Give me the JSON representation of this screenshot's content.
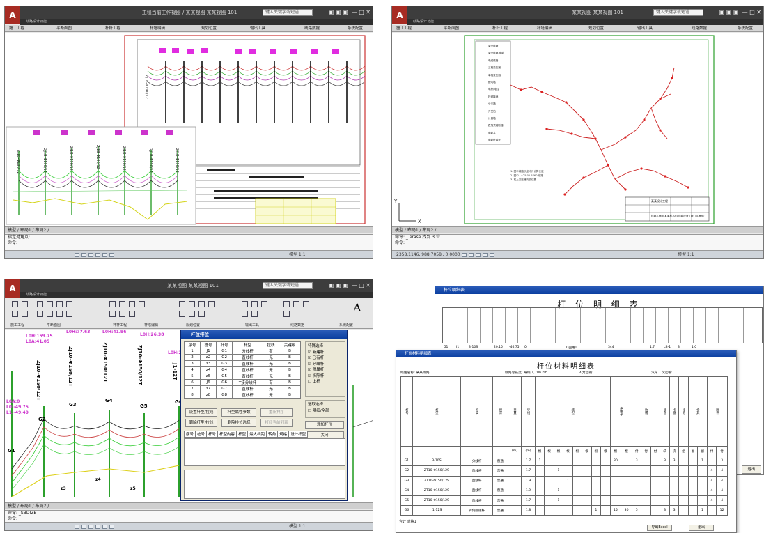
{
  "q1": {
    "title": "工程当前工作视图 / 某某视图 某某视图 101",
    "search_placeholder": "键入关键字或短语",
    "qat": "线路设计功能",
    "menus": [
      "施工工程",
      "平断面图",
      "杆杆工程",
      "杆塔编辑",
      "规划位置",
      "输出工具",
      "线路数据",
      "系统配置"
    ],
    "tabs": "模型 / 布局1 / 布局2 /",
    "cmd_lines": [
      "指定对角点:",
      "命令:"
    ],
    "plan_labels": [
      "ZJ1B-Φ190/12",
      "ZJ1B-Φ190/12",
      "ZJ1B-Φ190/12",
      "ZJ1B-Φ190/12",
      "ZJ1B-Φ190/12",
      "ZJ1B-Φ190/12",
      "ZJ1B-Φ190/12",
      "ZJ1B-Φ190/12"
    ],
    "status_left": "模型",
    "status_right": "模型 1:1"
  },
  "q2": {
    "title": "某某视图 某某视图 101",
    "search_placeholder": "键入关键字或短语",
    "qat": "线路设计功能",
    "menus": [
      "施工工程",
      "平断面图",
      "杆杆工程",
      "杆塔编辑",
      "规划位置",
      "输出工具",
      "线路数据",
      "系统配置"
    ],
    "legend": [
      "架空线路",
      "架空线路-电缆",
      "电缆线路",
      "三相变压器",
      "单相变压器",
      "配电箱",
      "电杆/电柱",
      "杆塔接地",
      "分支箱",
      "开关站",
      "计量箱",
      "跌落式熔断器",
      "电缆井",
      "电缆终端头"
    ],
    "notes": [
      "1. 图中线路长度均为计算长度",
      "2. 图中 L=25.05 5760 线路...",
      "3. 柱上变压器安装位置..."
    ],
    "title_block": {
      "company": "某某设计工程",
      "drawing": "线路平面图/某某村10kV线路改造工程（平面图）"
    },
    "tabs": "模型 / 布局1 / 布局2 /",
    "cmd_lines": [
      "命令: _.erase 找到 3 个",
      "命令:"
    ],
    "coords": "2358.1146, 988.7058 , 0.0000",
    "status_right": "模型 1:1"
  },
  "q3": {
    "title": "某某视图 某某视图 101",
    "search_placeholder": "键入关键字或短语",
    "qat": "线路设计功能",
    "ribbon_groups": [
      "施工工程",
      "平断面图",
      "杆杆工程",
      "杆塔编辑",
      "规划位置",
      "输出工具",
      "线路数据",
      "系统配置"
    ],
    "profile_labels": [
      {
        "name": "ZJ10-Φ150/12T",
        "g": "G1"
      },
      {
        "name": "ZJ10-Φ150/12T",
        "g": "G2"
      },
      {
        "name": "ZJ10-Φ150/12T",
        "g": "G3"
      },
      {
        "name": "ZJ10-Φ150/12T",
        "g": "G4"
      },
      {
        "name": "ZJ10-Φ150/12T",
        "g": "G5"
      },
      {
        "name": "J1-12T",
        "g": "G6"
      }
    ],
    "top_labels": [
      "L0H:159.75",
      "L0A:41.05",
      "L0H:77.63",
      "L0H:41.96",
      "L0H:26.38",
      "L0H:20."
    ],
    "left_labels": [
      "L0A:0",
      "L0:-49.75",
      "L1:-49.49"
    ],
    "spans": [
      "z3",
      "z4",
      "z5"
    ],
    "tabs": "模型 / 布局1 / 布局2 /",
    "cmd_lines": [
      "命令: _SBDIZB",
      "命令:"
    ],
    "status_right": "模型 1:1",
    "dialog": {
      "title": "杆位排位",
      "columns": [
        "序号",
        "桩号",
        "杆号",
        "杆型",
        "拉线",
        "关键级"
      ],
      "rows": [
        [
          "1",
          "J1",
          "G1",
          "分线杆",
          "有",
          "B"
        ],
        [
          "2",
          "z2",
          "G2",
          "直线杆",
          "无",
          "B"
        ],
        [
          "3",
          "z3",
          "G3",
          "直线杆",
          "无",
          "B"
        ],
        [
          "4",
          "z4",
          "G4",
          "直线杆",
          "无",
          "B"
        ],
        [
          "5",
          "z5",
          "G5",
          "直线杆",
          "无",
          "B"
        ],
        [
          "6",
          "J6",
          "G6",
          "T接分歧杆",
          "有",
          "B"
        ],
        [
          "7",
          "z7",
          "G7",
          "直线杆",
          "无",
          "B"
        ],
        [
          "8",
          "z8",
          "G8",
          "直线杆",
          "无",
          "B"
        ]
      ],
      "options_title": "特殊选择",
      "options": [
        "新建杆",
        "已有杆",
        "分歧杆",
        "附属杆",
        "拆除杆",
        "上杆"
      ],
      "checked": [
        true,
        true,
        true,
        true,
        true,
        false
      ],
      "range_title": "选取选择",
      "range_option": "明细/全部",
      "buttons": [
        "设置杆型/拉线",
        "杆型属性参数",
        "重新排序",
        "添加杆位",
        "删除杆型/拉线",
        "删除排位选择",
        "打印当前列表",
        "关闭"
      ],
      "columns2": [
        "序号",
        "桩号",
        "杆号",
        "杆型内容",
        "杆型",
        "最大档距",
        "转角",
        "规格",
        "设计杆型"
      ]
    }
  },
  "q4": {
    "back_window_title": "杆位明细表",
    "back_title": "杆 位 明 细 表",
    "back_first_row": [
      "G1",
      "J1",
      "3-10S",
      "",
      "20.15",
      "-46.75",
      "",
      "",
      "0",
      "",
      "",
      "G回路1",
      "344",
      "",
      "",
      "1.7",
      "LB-1",
      "3",
      "",
      "1.0"
    ],
    "front_window_title": "杆位材料明细表",
    "front_title": "杆位材料明细表",
    "info": {
      "line_name": "线路名称: 某某线路",
      "total": "线路总长度: 导线 1,708 km",
      "labor": "人力运输:",
      "vehicle": "汽车二次运输:"
    },
    "headers": [
      "杆号",
      "杆型",
      "杆高",
      "埋深",
      "重量",
      "导线",
      "横担",
      "绝缘子",
      "拉线",
      "底盘",
      "卡盘",
      "接地",
      "金具",
      "附件"
    ],
    "units": [
      "(m)",
      "(m)",
      "(t)",
      "根",
      "根",
      "付",
      "块",
      "块",
      "组",
      "副",
      "付"
    ],
    "rows": [
      [
        "G1",
        "3-10S",
        "分线杆",
        "普通",
        "",
        "1.7",
        "1",
        "",
        "",
        "",
        "",
        "",
        "",
        "",
        "30",
        "",
        "3",
        "",
        "",
        "3",
        "3",
        "",
        "",
        "1",
        "",
        "3"
      ],
      [
        "G2",
        "ZT10-Φ150/12S",
        "直线杆",
        "普通",
        "",
        "1.7",
        "",
        "",
        "1",
        "",
        "",
        "",
        "",
        "",
        "",
        "",
        "",
        "",
        "",
        "",
        "",
        "",
        "",
        "",
        "4",
        "4"
      ],
      [
        "G3",
        "ZT10-Φ150/12S",
        "直线杆",
        "普通",
        "",
        "1.9",
        "",
        "",
        "",
        "1",
        "",
        "",
        "",
        "",
        "",
        "",
        "",
        "",
        "",
        "",
        "",
        "",
        "",
        "",
        "4",
        "4"
      ],
      [
        "G4",
        "ZT10-Φ150/12S",
        "直线杆",
        "普通",
        "",
        "1.9",
        "",
        "",
        "1",
        "",
        "",
        "",
        "",
        "",
        "",
        "",
        "",
        "",
        "",
        "",
        "",
        "",
        "",
        "",
        "4",
        "4"
      ],
      [
        "G5",
        "ZT10-Φ150/12S",
        "直线杆",
        "普通",
        "",
        "1.7",
        "",
        "",
        "1",
        "",
        "",
        "",
        "",
        "",
        "",
        "",
        "",
        "",
        "",
        "",
        "",
        "",
        "",
        "",
        "4",
        "4"
      ],
      [
        "G6",
        "J1-12S",
        "转角耐张杆",
        "普通",
        "",
        "1.8",
        "",
        "",
        "",
        "",
        "",
        "",
        "1",
        "",
        "15",
        "30",
        "5",
        "",
        "",
        "3",
        "3",
        "",
        "",
        "1",
        "",
        "12"
      ]
    ],
    "bottom_tabs": "合计  表格1",
    "buttons": [
      "导出Excel",
      "退出"
    ],
    "back_buttons": [
      "退出"
    ]
  }
}
